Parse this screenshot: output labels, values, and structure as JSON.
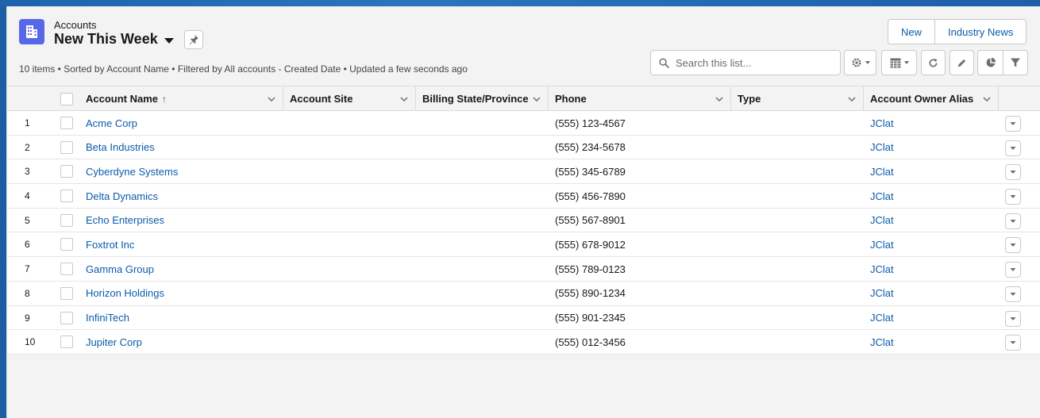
{
  "header": {
    "object_label": "Accounts",
    "list_view_name": "New This Week",
    "subtitle": "10 items • Sorted by Account Name • Filtered by All accounts - Created Date • Updated a few seconds ago",
    "buttons": {
      "new": "New",
      "industry_news": "Industry News"
    },
    "search": {
      "placeholder": "Search this list...",
      "value": ""
    },
    "icons": {
      "object": "building-icon",
      "pin": "pin-icon",
      "settings": "gear-icon",
      "display_as": "table-icon",
      "refresh": "refresh-icon",
      "edit": "pencil-icon",
      "charts": "pie-chart-icon",
      "filter": "filter-icon"
    },
    "accent_color": "#5867e8"
  },
  "table": {
    "columns": {
      "account_name": "Account Name",
      "account_site": "Account Site",
      "billing_state": "Billing State/Province",
      "phone": "Phone",
      "type": "Type",
      "owner_alias": "Account Owner Alias"
    },
    "rows": [
      {
        "num": "1",
        "name": "Acme Corp",
        "site": "",
        "state": "",
        "phone": "(555) 123-4567",
        "type": "",
        "owner": "JClat"
      },
      {
        "num": "2",
        "name": "Beta Industries",
        "site": "",
        "state": "",
        "phone": "(555) 234-5678",
        "type": "",
        "owner": "JClat"
      },
      {
        "num": "3",
        "name": "Cyberdyne Systems",
        "site": "",
        "state": "",
        "phone": "(555) 345-6789",
        "type": "",
        "owner": "JClat"
      },
      {
        "num": "4",
        "name": "Delta Dynamics",
        "site": "",
        "state": "",
        "phone": "(555) 456-7890",
        "type": "",
        "owner": "JClat"
      },
      {
        "num": "5",
        "name": "Echo Enterprises",
        "site": "",
        "state": "",
        "phone": "(555) 567-8901",
        "type": "",
        "owner": "JClat"
      },
      {
        "num": "6",
        "name": "Foxtrot Inc",
        "site": "",
        "state": "",
        "phone": "(555) 678-9012",
        "type": "",
        "owner": "JClat"
      },
      {
        "num": "7",
        "name": "Gamma Group",
        "site": "",
        "state": "",
        "phone": "(555) 789-0123",
        "type": "",
        "owner": "JClat"
      },
      {
        "num": "8",
        "name": "Horizon Holdings",
        "site": "",
        "state": "",
        "phone": "(555) 890-1234",
        "type": "",
        "owner": "JClat"
      },
      {
        "num": "9",
        "name": "InfiniTech",
        "site": "",
        "state": "",
        "phone": "(555) 901-2345",
        "type": "",
        "owner": "JClat"
      },
      {
        "num": "10",
        "name": "Jupiter Corp",
        "site": "",
        "state": "",
        "phone": "(555) 012-3456",
        "type": "",
        "owner": "JClat"
      }
    ]
  }
}
